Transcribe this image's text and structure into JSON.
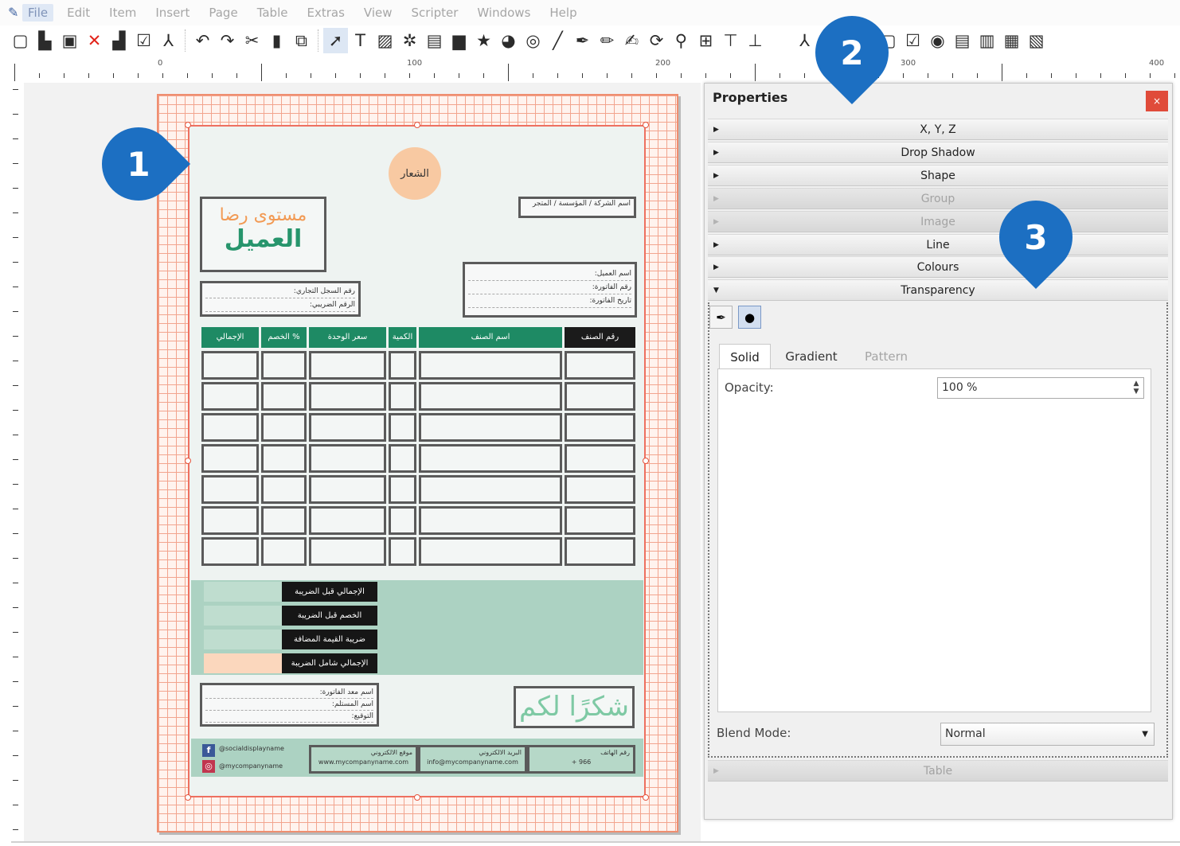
{
  "menu": {
    "items": [
      "File",
      "Edit",
      "Item",
      "Insert",
      "Page",
      "Table",
      "Extras",
      "View",
      "Scripter",
      "Windows",
      "Help"
    ]
  },
  "toolbar": {
    "icons": [
      "new-document-icon",
      "open-icon",
      "save-icon",
      "close-icon",
      "print-icon",
      "preflight-check-icon",
      "pdf-export-icon",
      "undo-icon",
      "redo-icon",
      "cut-icon",
      "copy-icon",
      "paste-icon",
      "select-icon",
      "text-frame-icon",
      "image-frame-icon",
      "render-frame-icon",
      "table-icon",
      "shape-icon",
      "polygon-icon",
      "arc-icon",
      "spiral-icon",
      "line-icon",
      "bezier-icon",
      "freehand-icon",
      "calligraphic-icon",
      "rotate-icon",
      "zoom-icon",
      "edit-text-icon",
      "link-frames-icon",
      "unlink-frames-icon",
      "measure-icon",
      "copy-properties-icon",
      "eyedropper-icon",
      "pdf-push-button-icon",
      "pdf-checkbox-icon",
      "pdf-radio-icon",
      "pdf-text-field-icon",
      "pdf-combo-box-icon",
      "pdf-list-box-icon",
      "pdf-annotation-icon"
    ]
  },
  "ruler": {
    "labels": [
      "0",
      "100",
      "200",
      "300",
      "400"
    ]
  },
  "document": {
    "logo_text": "الشعار",
    "title_line1": "مستوى رضا",
    "title_line2": "العميل",
    "company_box": "اسم الشركة / المؤسسة / المتجر",
    "customer_box": [
      "اسم العميل:",
      "رقم الفاتورة:",
      "تاريخ الفاتورة:"
    ],
    "register_box": [
      "رقم السجل التجاري:",
      "الرقم الضريبي:"
    ],
    "table_headers": [
      "الإجمالي",
      "الخصم %",
      "سعر الوحدة",
      "الكمية",
      "اسم الصنف",
      "رقم الصنف"
    ],
    "totals": [
      "الإجمالي قبل الضريبة",
      "الخصم قبل الضريبة",
      "ضريبة القيمة المضافة",
      "الإجمالي شامل الضريبة"
    ],
    "signature_box": [
      "اسم معد الفاتورة:",
      "اسم المستلم:",
      "التوقيع:"
    ],
    "thanks": "شكرًا لكم",
    "footer": {
      "social_facebook": "@socialdisplayname",
      "social_instagram": "@mycompanyname",
      "website_label": "موقع الالكتروني",
      "website_value": "www.mycompanyname.com",
      "email_label": "البريد الالكتروني",
      "email_value": "info@mycompanyname.com",
      "phone_label": "رقم الهاتف",
      "phone_value": "+ 966"
    }
  },
  "properties": {
    "title": "Properties",
    "close": "×",
    "sections": [
      {
        "label": "X, Y, Z",
        "enabled": true,
        "expanded": false
      },
      {
        "label": "Drop Shadow",
        "enabled": true,
        "expanded": false
      },
      {
        "label": "Shape",
        "enabled": true,
        "expanded": false
      },
      {
        "label": "Group",
        "enabled": false,
        "expanded": false
      },
      {
        "label": "Image",
        "enabled": false,
        "expanded": false
      },
      {
        "label": "Line",
        "enabled": true,
        "expanded": false
      },
      {
        "label": "Colours",
        "enabled": true,
        "expanded": false
      },
      {
        "label": "Transparency",
        "enabled": true,
        "expanded": true
      }
    ],
    "transparency": {
      "tabs": [
        "Solid",
        "Gradient",
        "Pattern"
      ],
      "active_tab": "Solid",
      "opacity_label": "Opacity:",
      "opacity_value": "100 %",
      "blend_label": "Blend Mode:",
      "blend_value": "Normal"
    },
    "table_section": "Table"
  },
  "callouts": [
    "1",
    "2",
    "3"
  ],
  "colors": {
    "accent_blue": "#1c6fc2",
    "invoice_green": "#1e8a64",
    "close_red": "#e04b3a",
    "grid_orange": "#f2a48e"
  }
}
